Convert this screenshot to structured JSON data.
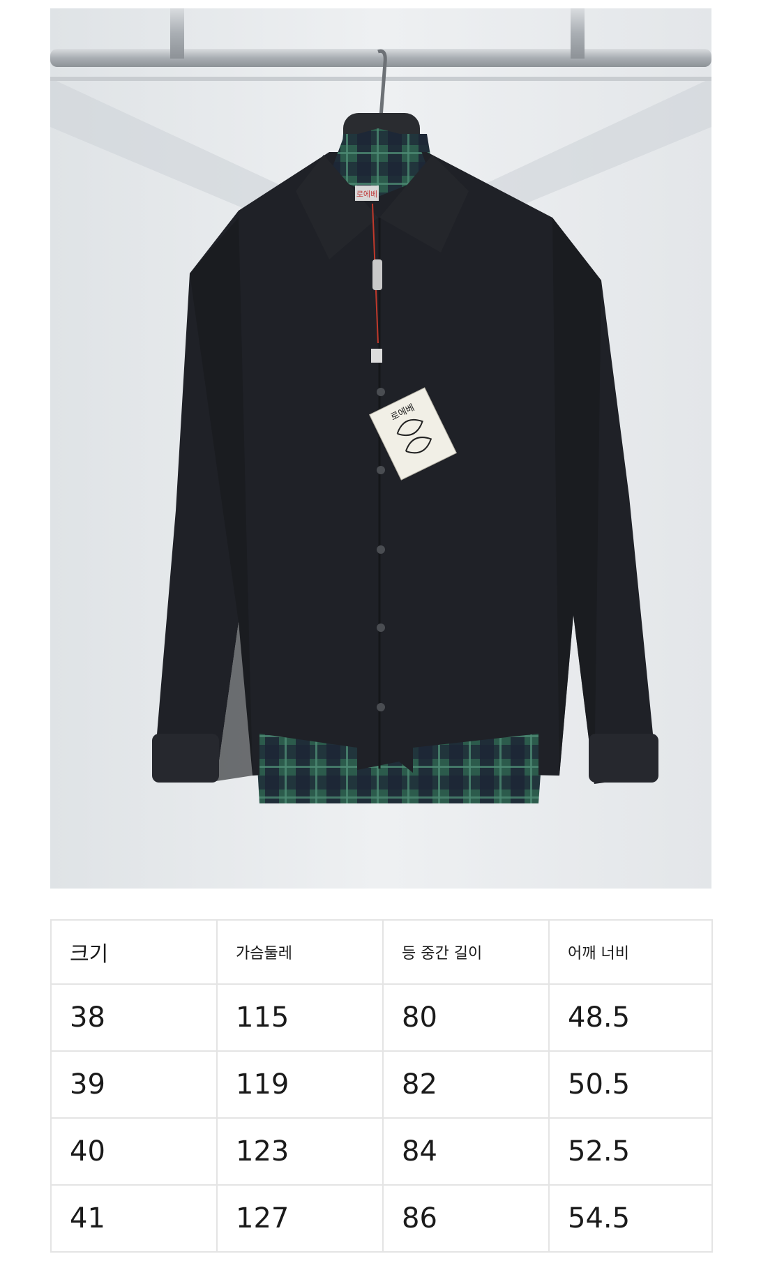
{
  "product_photo": {
    "description_icon": "shirt-on-hanger",
    "hang_tag_text": "로에베",
    "collar_label_text": "로에베",
    "colors": {
      "shirt": "#1f2127",
      "plaid_green": "#2c5b4c",
      "plaid_navy": "#1c2535",
      "wall": "#e9ecef",
      "rail": "#b9bdc2"
    }
  },
  "size_table": {
    "headers": [
      "크기",
      "가슴둘레",
      "등 중간 길이",
      "어깨 너비"
    ],
    "rows": [
      [
        "38",
        "115",
        "80",
        "48.5"
      ],
      [
        "39",
        "119",
        "82",
        "50.5"
      ],
      [
        "40",
        "123",
        "84",
        "52.5"
      ],
      [
        "41",
        "127",
        "86",
        "54.5"
      ]
    ]
  }
}
